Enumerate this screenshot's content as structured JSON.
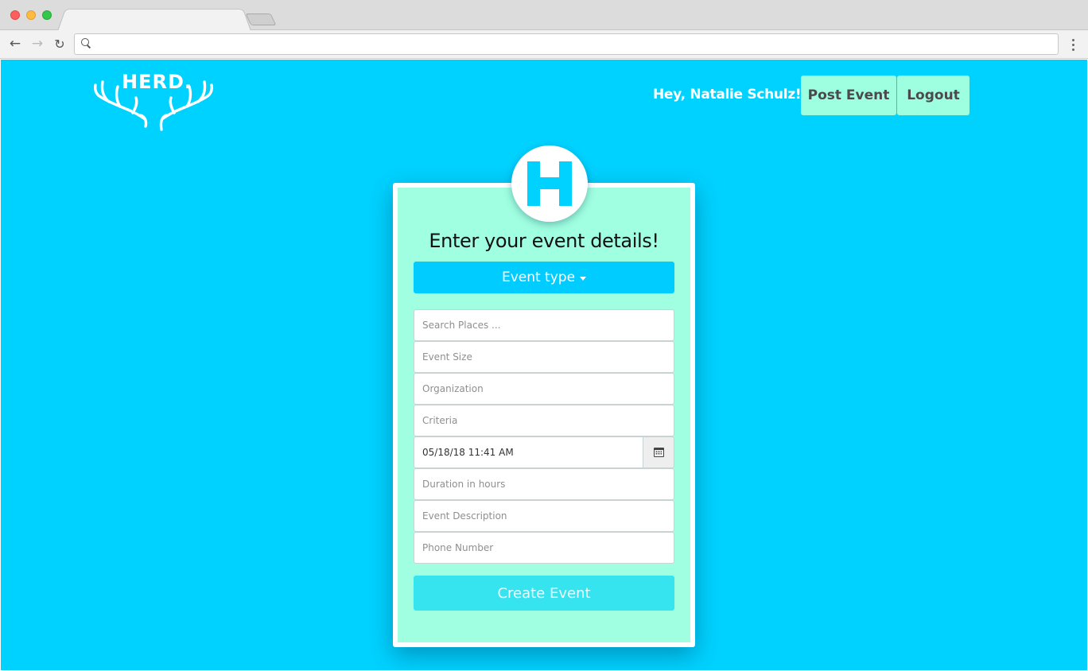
{
  "browser": {
    "tab_title": "",
    "address": ""
  },
  "header": {
    "logo_text": "HERD.",
    "greeting": "Hey, Natalie Schulz!",
    "post_event_label": "Post Event",
    "logout_label": "Logout"
  },
  "form": {
    "badge_letter": "H",
    "title": "Enter your event details!",
    "event_type_label": "Event type",
    "fields": {
      "search_places_placeholder": "Search Places ...",
      "event_size_placeholder": "Event Size",
      "organization_placeholder": "Organization",
      "criteria_placeholder": "Criteria",
      "datetime_value": "05/18/18 11:41 AM",
      "duration_placeholder": "Duration in hours",
      "description_placeholder": "Event Description",
      "phone_placeholder": "Phone Number"
    },
    "submit_label": "Create Event"
  },
  "icons": {
    "back": "arrow-left-icon",
    "forward": "arrow-right-icon",
    "reload": "reload-icon",
    "search": "search-icon",
    "menu": "more-vertical-icon",
    "logo": "antlers-icon",
    "calendar": "calendar-icon",
    "caret": "caret-down-icon"
  },
  "colors": {
    "page_background": "#00d2ff",
    "card_background": "#a0ffe0",
    "button_mint": "#9dffdf",
    "dropdown_blue": "#00ccff",
    "submit_cyan": "#36e4f0"
  }
}
